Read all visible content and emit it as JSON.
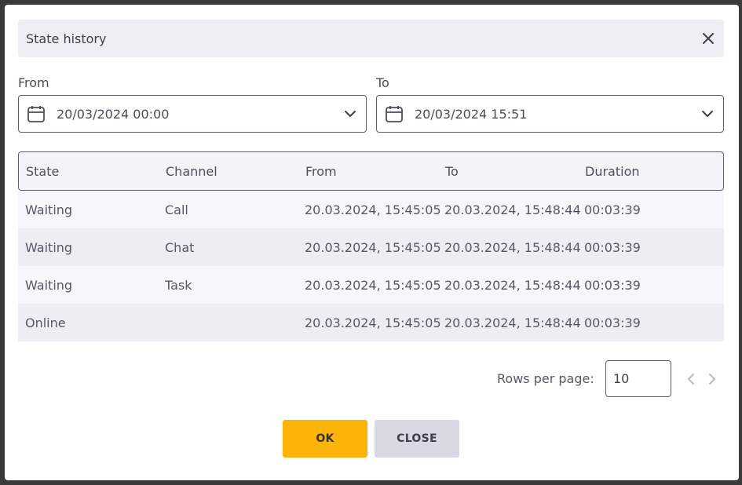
{
  "dialog": {
    "title": "State history",
    "close_icon": "close-icon"
  },
  "filters": {
    "from_label": "From",
    "from_value": "20/03/2024 00:00",
    "to_label": "To",
    "to_value": "20/03/2024 15:51"
  },
  "table": {
    "columns": [
      "State",
      "Channel",
      "From",
      "To",
      "Duration"
    ],
    "rows": [
      [
        "Waiting",
        "Call",
        "20.03.2024, 15:45:05",
        "20.03.2024, 15:48:44",
        "00:03:39"
      ],
      [
        "Waiting",
        "Chat",
        "20.03.2024, 15:45:05",
        "20.03.2024, 15:48:44",
        "00:03:39"
      ],
      [
        "Waiting",
        "Task",
        "20.03.2024, 15:45:05",
        "20.03.2024, 15:48:44",
        "00:03:39"
      ],
      [
        "Online",
        "",
        "20.03.2024, 15:45:05",
        "20.03.2024, 15:48:44",
        "00:03:39"
      ]
    ]
  },
  "pagination": {
    "rows_per_page_label": "Rows per page:",
    "rows_per_page_value": "10"
  },
  "buttons": {
    "ok_label": "OK",
    "close_label": "CLOSE"
  },
  "colors": {
    "accent": "#fbb40a",
    "secondary_button": "#d8d9e2",
    "header_bg": "#eeeff4"
  }
}
